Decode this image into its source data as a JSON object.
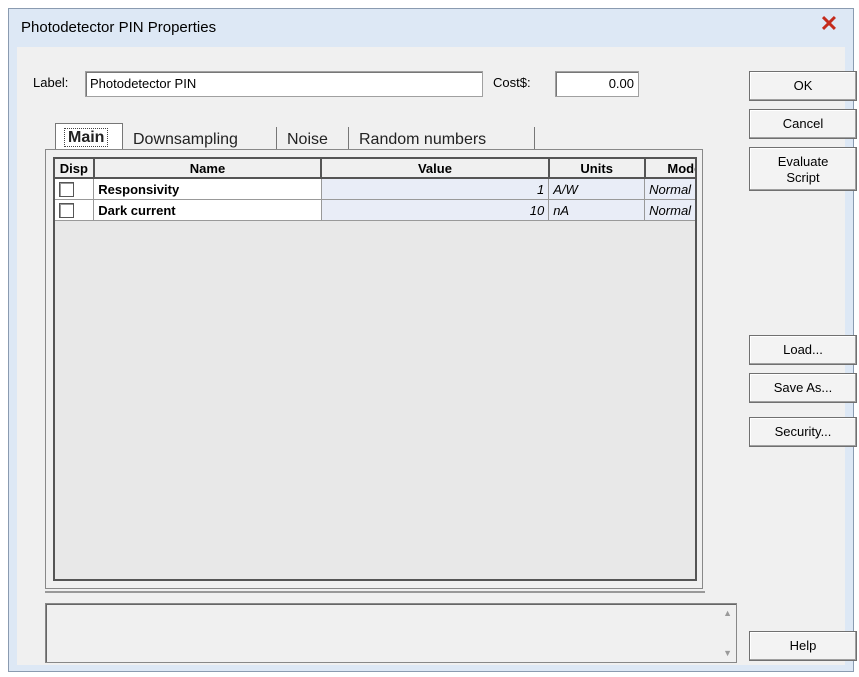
{
  "window": {
    "title": "Photodetector PIN Properties",
    "close_glyph": "✕"
  },
  "form": {
    "label_caption": "Label:",
    "label_value": "Photodetector PIN",
    "cost_caption": "Cost$:",
    "cost_value": "0.00"
  },
  "buttons": {
    "ok": "OK",
    "cancel": "Cancel",
    "evaluate_script_line1": "Evaluate",
    "evaluate_script_line2": "Script",
    "load": "Load...",
    "save_as": "Save As...",
    "security": "Security...",
    "help": "Help"
  },
  "tabs": [
    {
      "label": "Main",
      "active": true
    },
    {
      "label": "Downsampling",
      "active": false
    },
    {
      "label": "Noise",
      "active": false
    },
    {
      "label": "Random numbers",
      "active": false
    }
  ],
  "table": {
    "columns": [
      "Disp",
      "Name",
      "Value",
      "Units",
      "Mode"
    ],
    "rows": [
      {
        "disp": false,
        "name": "Responsivity",
        "value": "1",
        "units": "A/W",
        "mode": "Normal"
      },
      {
        "disp": false,
        "name": "Dark current",
        "value": "10",
        "units": "nA",
        "mode": "Normal"
      }
    ]
  },
  "icons": {
    "close": "close-icon",
    "scroll_up": "scroll-up-arrow-icon",
    "scroll_down": "scroll-down-arrow-icon"
  },
  "colors": {
    "titlebar_bg": "#dde8f5",
    "close_red": "#c42b1c",
    "value_cell_bg": "#e9edf7"
  }
}
